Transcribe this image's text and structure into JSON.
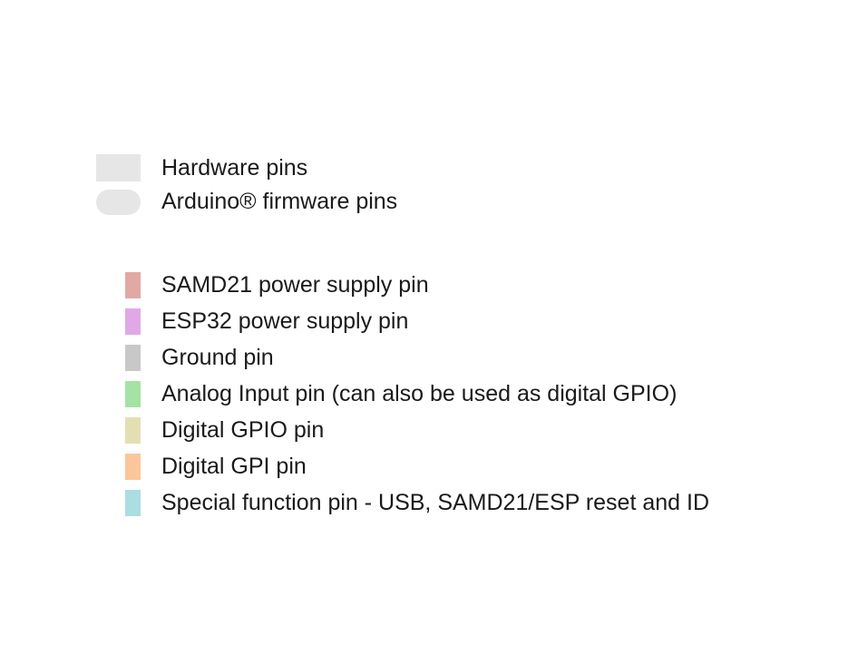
{
  "pin_types": [
    {
      "label": "Hardware pins",
      "shape": "rectangle",
      "color": "#e6e6e6"
    },
    {
      "label": "Arduino® firmware pins",
      "shape": "rounded",
      "color": "#e6e6e6"
    }
  ],
  "pin_functions": [
    {
      "label": "SAMD21 power supply pin",
      "color": "#e2a9a4"
    },
    {
      "label": "ESP32 power supply pin",
      "color": "#e0a9e6"
    },
    {
      "label": "Ground pin",
      "color": "#c8c8c8"
    },
    {
      "label": "Analog Input pin (can also be used as digital GPIO)",
      "color": "#a4e3a3"
    },
    {
      "label": "Digital GPIO pin",
      "color": "#e4dfb3"
    },
    {
      "label": "Digital GPI pin",
      "color": "#fbc69a"
    },
    {
      "label": "Special function pin - USB, SAMD21/ESP reset and ID",
      "color": "#acdde1"
    }
  ]
}
